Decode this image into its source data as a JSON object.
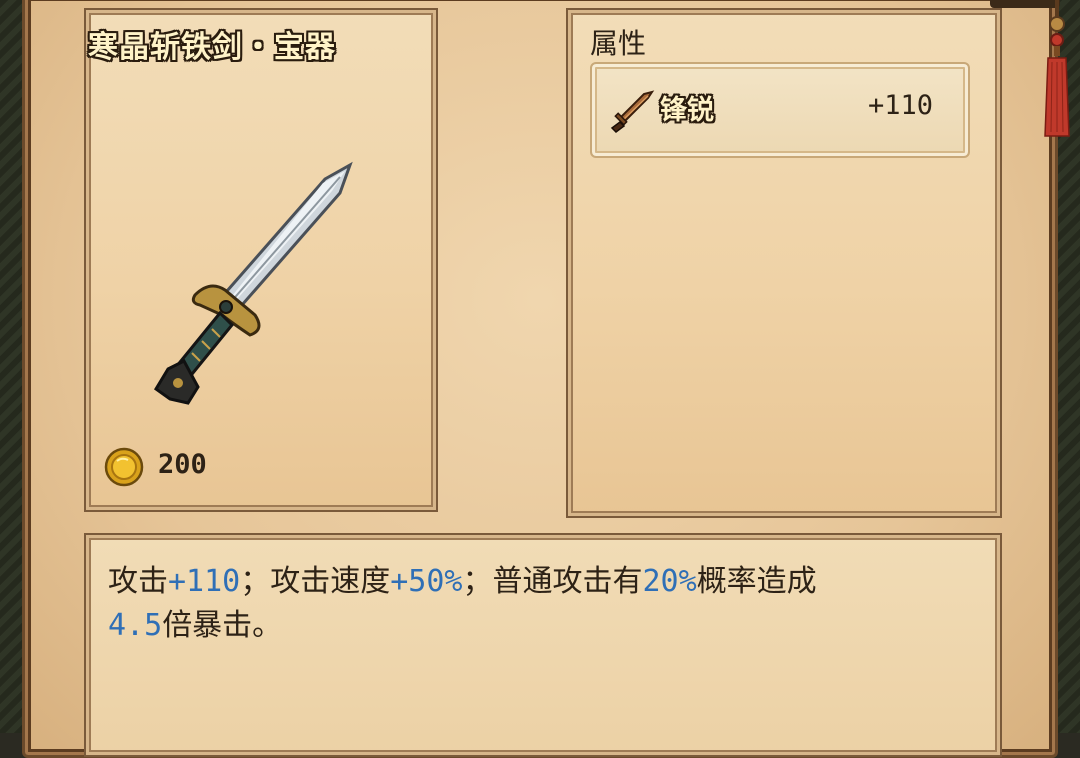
{
  "item": {
    "title": "寒晶斩铁剑・宝器",
    "price": "200",
    "price_icon": "gold-coin-icon"
  },
  "attributes": {
    "header": "属性",
    "rows": [
      {
        "icon": "sword-icon",
        "name": "锋锐",
        "value": "+110"
      }
    ]
  },
  "description": {
    "parts": [
      {
        "text": "攻击",
        "hl": false
      },
      {
        "text": "+110",
        "hl": true
      },
      {
        "text": "；攻击速度",
        "hl": false
      },
      {
        "text": "+50%",
        "hl": true
      },
      {
        "text": "；普通攻击有",
        "hl": false
      },
      {
        "text": "20%",
        "hl": true
      },
      {
        "text": "概率造成",
        "hl": false
      },
      {
        "text": "4.5",
        "hl": true
      },
      {
        "text": "倍暴击。",
        "hl": false
      }
    ]
  },
  "colors": {
    "highlight": "#2f6fb6",
    "text": "#2d2216",
    "parchment": "#efd2a6"
  }
}
